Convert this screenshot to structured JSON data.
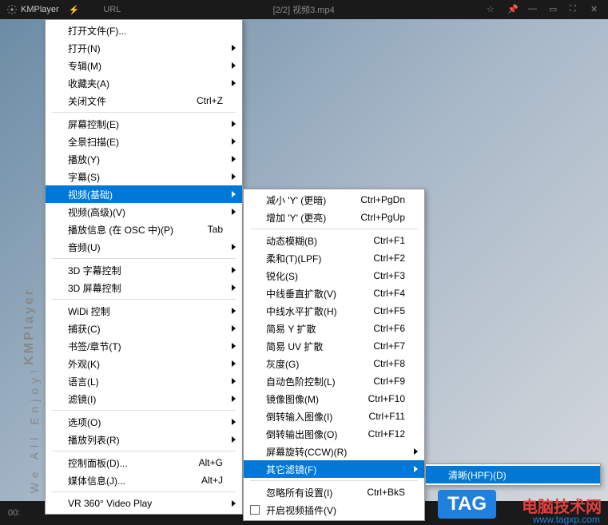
{
  "titlebar": {
    "app_name": "KMPlayer",
    "url_label": "URL",
    "title": "[2/2] 视频3.mp4"
  },
  "menu": {
    "items": [
      {
        "label": "打开文件(F)...",
        "type": "item"
      },
      {
        "label": "打开(N)",
        "type": "submenu"
      },
      {
        "label": "专辑(M)",
        "type": "submenu"
      },
      {
        "label": "收藏夹(A)",
        "type": "submenu"
      },
      {
        "label": "关闭文件",
        "shortcut": "Ctrl+Z",
        "type": "item"
      },
      {
        "type": "separator"
      },
      {
        "label": "屏幕控制(E)",
        "type": "submenu"
      },
      {
        "label": "全景扫描(E)",
        "type": "submenu"
      },
      {
        "label": "播放(Y)",
        "type": "submenu"
      },
      {
        "label": "字幕(S)",
        "type": "submenu"
      },
      {
        "label": "视频(基础)",
        "type": "submenu",
        "highlighted": true
      },
      {
        "label": "视频(高级)(V)",
        "type": "submenu"
      },
      {
        "label": "播放信息 (在 OSC 中)(P)",
        "shortcut": "Tab",
        "type": "item"
      },
      {
        "label": "音频(U)",
        "type": "submenu"
      },
      {
        "type": "separator"
      },
      {
        "label": "3D 字幕控制",
        "type": "submenu"
      },
      {
        "label": "3D 屏幕控制",
        "type": "submenu"
      },
      {
        "type": "separator"
      },
      {
        "label": "WiDi 控制",
        "type": "submenu"
      },
      {
        "label": "捕获(C)",
        "type": "submenu"
      },
      {
        "label": "书签/章节(T)",
        "type": "submenu"
      },
      {
        "label": "外观(K)",
        "type": "submenu"
      },
      {
        "label": "语言(L)",
        "type": "submenu"
      },
      {
        "label": "滤镜(I)",
        "type": "submenu"
      },
      {
        "type": "separator"
      },
      {
        "label": "选项(O)",
        "type": "submenu"
      },
      {
        "label": "播放列表(R)",
        "type": "submenu"
      },
      {
        "type": "separator"
      },
      {
        "label": "控制面板(D)...",
        "shortcut": "Alt+G",
        "type": "item"
      },
      {
        "label": "媒体信息(J)...",
        "shortcut": "Alt+J",
        "type": "item"
      },
      {
        "type": "separator"
      },
      {
        "label": "VR 360° Video Play",
        "type": "submenu"
      }
    ]
  },
  "submenu": {
    "items": [
      {
        "label": "减小 'Y' (更暗)",
        "shortcut": "Ctrl+PgDn",
        "type": "item"
      },
      {
        "label": "增加 'Y' (更亮)",
        "shortcut": "Ctrl+PgUp",
        "type": "item"
      },
      {
        "type": "separator"
      },
      {
        "label": "动态模糊(B)",
        "shortcut": "Ctrl+F1",
        "type": "item"
      },
      {
        "label": "柔和(T)(LPF)",
        "shortcut": "Ctrl+F2",
        "type": "item"
      },
      {
        "label": "锐化(S)",
        "shortcut": "Ctrl+F3",
        "type": "item"
      },
      {
        "label": "中线垂直扩散(V)",
        "shortcut": "Ctrl+F4",
        "type": "item"
      },
      {
        "label": "中线水平扩散(H)",
        "shortcut": "Ctrl+F5",
        "type": "item"
      },
      {
        "label": "简易 Y 扩散",
        "shortcut": "Ctrl+F6",
        "type": "item"
      },
      {
        "label": "简易 UV 扩散",
        "shortcut": "Ctrl+F7",
        "type": "item"
      },
      {
        "label": "灰度(G)",
        "shortcut": "Ctrl+F8",
        "type": "item"
      },
      {
        "label": "自动色阶控制(L)",
        "shortcut": "Ctrl+F9",
        "type": "item"
      },
      {
        "label": "镜像图像(M)",
        "shortcut": "Ctrl+F10",
        "type": "item"
      },
      {
        "label": "倒转输入图像(I)",
        "shortcut": "Ctrl+F11",
        "type": "item"
      },
      {
        "label": "倒转输出图像(O)",
        "shortcut": "Ctrl+F12",
        "type": "item"
      },
      {
        "label": "屏幕旋转(CCW)(R)",
        "type": "submenu"
      },
      {
        "label": "其它滤镜(F)",
        "type": "submenu",
        "highlighted": true
      },
      {
        "type": "separator"
      },
      {
        "label": "忽略所有设置(I)",
        "shortcut": "Ctrl+BkS",
        "type": "item"
      },
      {
        "label": "开启视频插件(V)",
        "type": "item",
        "checkbox": true
      }
    ]
  },
  "submenu2": {
    "items": [
      {
        "label": "清晰(HPF)(D)",
        "type": "item",
        "highlighted": true
      }
    ]
  },
  "sidebar": {
    "enjoy": "We All Enjoy!",
    "logo": "KMPlayer"
  },
  "bottombar": {
    "time": "00:"
  },
  "watermark": {
    "badge": "TAG",
    "text": "电脑技术网",
    "url": "www.tagxp.com"
  }
}
